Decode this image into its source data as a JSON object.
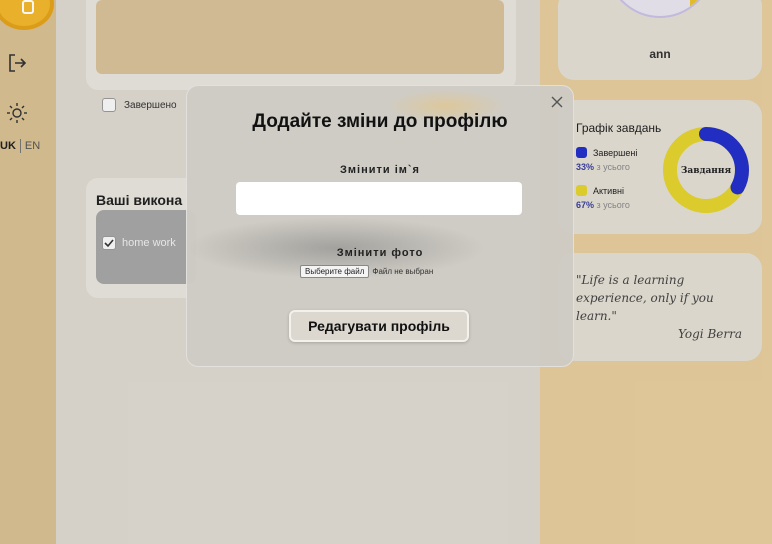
{
  "rail": {
    "add_icon": "add-task-icon",
    "logout_icon": "logout-icon",
    "theme_icon": "sun-icon",
    "lang_uk": "UK",
    "lang_en": "EN"
  },
  "tasks": {
    "done_label": "Завершено",
    "completed_heading": "Ваші викона",
    "completed_item": "home work"
  },
  "profile": {
    "name": "ann"
  },
  "stats": {
    "title": "Графік завдань",
    "center_label": "Завдання",
    "completed_label": "Завершені",
    "completed_percent": "33%",
    "completed_suffix": "з усього",
    "active_label": "Активні",
    "active_percent": "67%",
    "active_suffix": "з усього",
    "completed_fraction": 0.33,
    "completed_color": "#2330c8",
    "active_color": "#e3d22e"
  },
  "quote": {
    "text": "\"Life is a learning experience, only if you learn.\"",
    "author": "Yogi Berra"
  },
  "modal": {
    "title": "Додайте зміни до профілю",
    "name_label": "Змінити ім`я",
    "name_value": "",
    "photo_label": "Змінити фото",
    "file_button": "Выберите файл",
    "file_status": "Файл не выбран",
    "submit_label": "Редагувати профіль"
  }
}
